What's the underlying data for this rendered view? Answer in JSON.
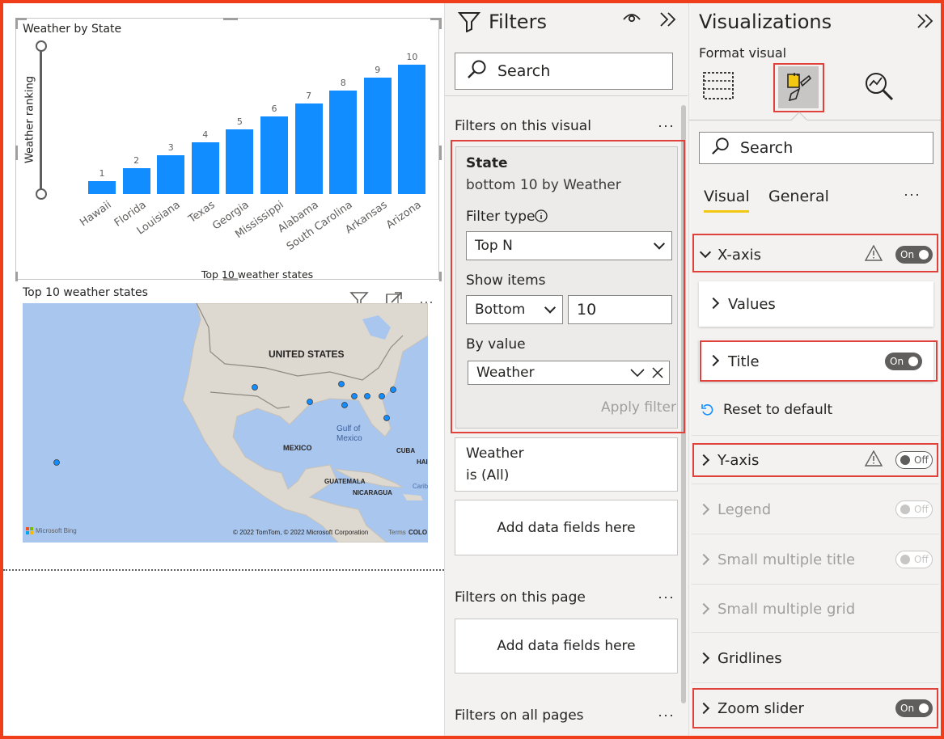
{
  "chart_data": {
    "type": "bar",
    "title": "Weather by State",
    "xlabel": "Top 10 weather states",
    "ylabel": "Weather ranking",
    "categories": [
      "Hawaii",
      "Florida",
      "Louisiana",
      "Texas",
      "Georgia",
      "Mississippi",
      "Alabama",
      "South Carolina",
      "Arkansas",
      "Arizona"
    ],
    "values": [
      1,
      2,
      3,
      4,
      5,
      6,
      7,
      8,
      9,
      10
    ],
    "ylim": [
      0,
      10
    ],
    "data_labels": true,
    "color": "#118dff"
  },
  "map": {
    "title": "Top 10 weather states",
    "labels": {
      "us": "UNITED STATES",
      "mexico": "MEXICO",
      "gulf": "Gulf of\nMexico",
      "cuba": "CUBA",
      "guatemala": "GUATEMALA",
      "nicaragua": "NICARAGUA",
      "hai": "HAI",
      "carib": "Carib",
      "bing": "Microsoft Bing",
      "copyright": "© 2022 TomTom, © 2022 Microsoft Corporation",
      "terms": "Terms",
      "colo": "COLO"
    },
    "icons": [
      "filter-icon",
      "focus-mode-icon",
      "more-options-icon"
    ],
    "more": "···"
  },
  "filters": {
    "title": "Filters",
    "search_placeholder": "Search",
    "on_visual_label": "Filters on this visual",
    "more": "···",
    "state_card": {
      "field": "State",
      "summary": "bottom 10 by Weather",
      "filter_type_label": "Filter type",
      "filter_type_value": "Top N",
      "show_items_label": "Show items",
      "show_items_direction": "Bottom",
      "show_items_count": "10",
      "by_value_label": "By value",
      "by_value_field": "Weather",
      "apply": "Apply filter"
    },
    "weather_card": {
      "field": "Weather",
      "summary": "is (All)"
    },
    "add_fields": "Add data fields here",
    "on_page_label": "Filters on this page",
    "on_all_pages_label": "Filters on all pages"
  },
  "viz": {
    "title": "Visualizations",
    "subtitle": "Format visual",
    "search_placeholder": "Search",
    "tabs": [
      "Visual",
      "General"
    ],
    "active_tab": "Visual",
    "more": "···",
    "sections": {
      "x_axis": {
        "label": "X-axis",
        "toggle": "On"
      },
      "values": {
        "label": "Values"
      },
      "title": {
        "label": "Title",
        "toggle": "On"
      },
      "reset": "Reset to default",
      "y_axis": {
        "label": "Y-axis",
        "toggle": "Off"
      },
      "legend": {
        "label": "Legend",
        "toggle": "Off"
      },
      "sm_title": {
        "label": "Small multiple title",
        "toggle": "Off"
      },
      "sm_grid": {
        "label": "Small multiple grid"
      },
      "gridlines": {
        "label": "Gridlines"
      },
      "zoom_slider": {
        "label": "Zoom slider",
        "toggle": "On"
      }
    },
    "accent": "#f2c811"
  },
  "colors": {
    "highlight": "#e0413a",
    "outer_border": "#f03e1b",
    "bar": "#118dff"
  }
}
